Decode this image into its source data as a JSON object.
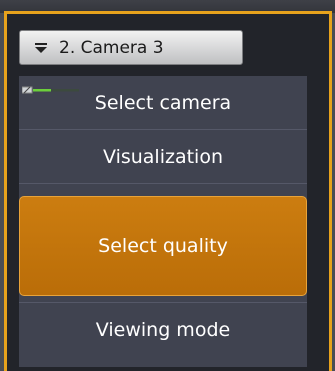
{
  "camera_selector": {
    "label": "2. Camera 3",
    "icon": "chevron-down-icon"
  },
  "menu": {
    "items": [
      {
        "label": "Select camera"
      },
      {
        "label": "Visualization"
      },
      {
        "label": "Select quality",
        "highlighted": true
      },
      {
        "label": "Viewing mode"
      }
    ]
  },
  "colors": {
    "frame_border": "#e7a21c",
    "menu_background": "#404350",
    "highlight": "#c47810",
    "text": "#ffffff"
  },
  "icons": {
    "signal": "signal-level-icon"
  }
}
